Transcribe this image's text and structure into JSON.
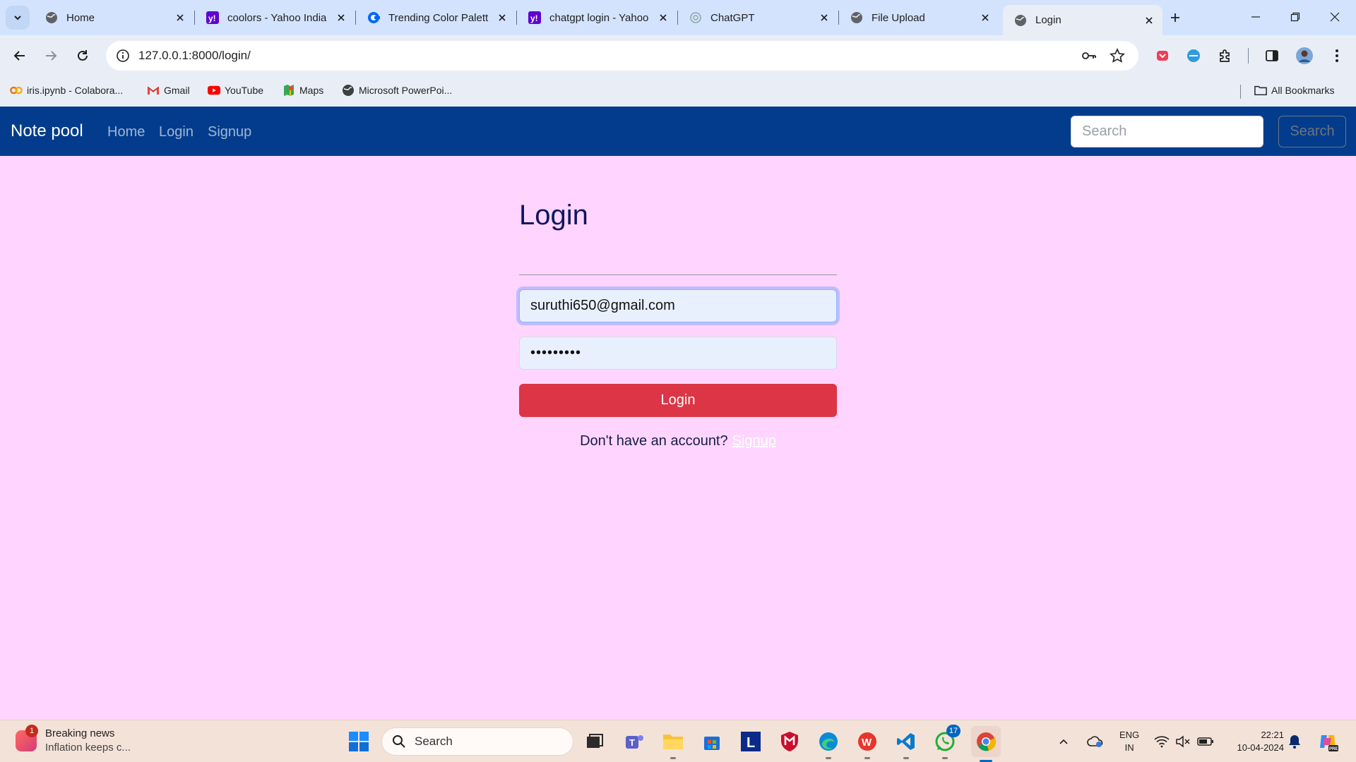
{
  "browser": {
    "tabs": [
      {
        "title": "Home",
        "favicon": "globe-icon",
        "active": false
      },
      {
        "title": "coolors - Yahoo India",
        "favicon": "yahoo-icon",
        "active": false
      },
      {
        "title": "Trending Color Palett",
        "favicon": "coolors-icon",
        "active": false
      },
      {
        "title": "chatgpt login - Yahoo",
        "favicon": "yahoo-icon",
        "active": false
      },
      {
        "title": "ChatGPT",
        "favicon": "chatgpt-icon",
        "active": false
      },
      {
        "title": "File Upload",
        "favicon": "globe-icon",
        "active": false
      },
      {
        "title": "Login",
        "favicon": "globe-icon",
        "active": true
      }
    ],
    "url": "127.0.0.1:8000/login/",
    "bookmarks": [
      {
        "label": "iris.ipynb - Colabora...",
        "icon": "colab-icon"
      },
      {
        "label": "Gmail",
        "icon": "gmail-icon"
      },
      {
        "label": "YouTube",
        "icon": "youtube-icon"
      },
      {
        "label": "Maps",
        "icon": "maps-icon"
      },
      {
        "label": "Microsoft PowerPoi...",
        "icon": "globe-icon"
      }
    ],
    "all_bookmarks_label": "All Bookmarks"
  },
  "navbar": {
    "brand": "Note pool",
    "links": [
      "Home",
      "Login",
      "Signup"
    ],
    "search_placeholder": "Search",
    "search_button": "Search"
  },
  "login": {
    "title": "Login",
    "email_value": "suruthi650@gmail.com",
    "password_value": "•••••••••",
    "submit_label": "Login",
    "prompt_text": "Don't have an account?",
    "signup_link": "Signup"
  },
  "taskbar": {
    "news_title": "Breaking news",
    "news_subtitle": "Inflation keeps c...",
    "news_badge": "1",
    "search_label": "Search",
    "whatsapp_badge": "17",
    "lang_line1": "ENG",
    "lang_line2": "IN",
    "time": "22:21",
    "date": "10-04-2024"
  },
  "colors": {
    "page_bg": "#ffd5ff",
    "navbar_bg": "#033c8c",
    "login_button": "#dc3545",
    "title_text": "#0f1660"
  }
}
